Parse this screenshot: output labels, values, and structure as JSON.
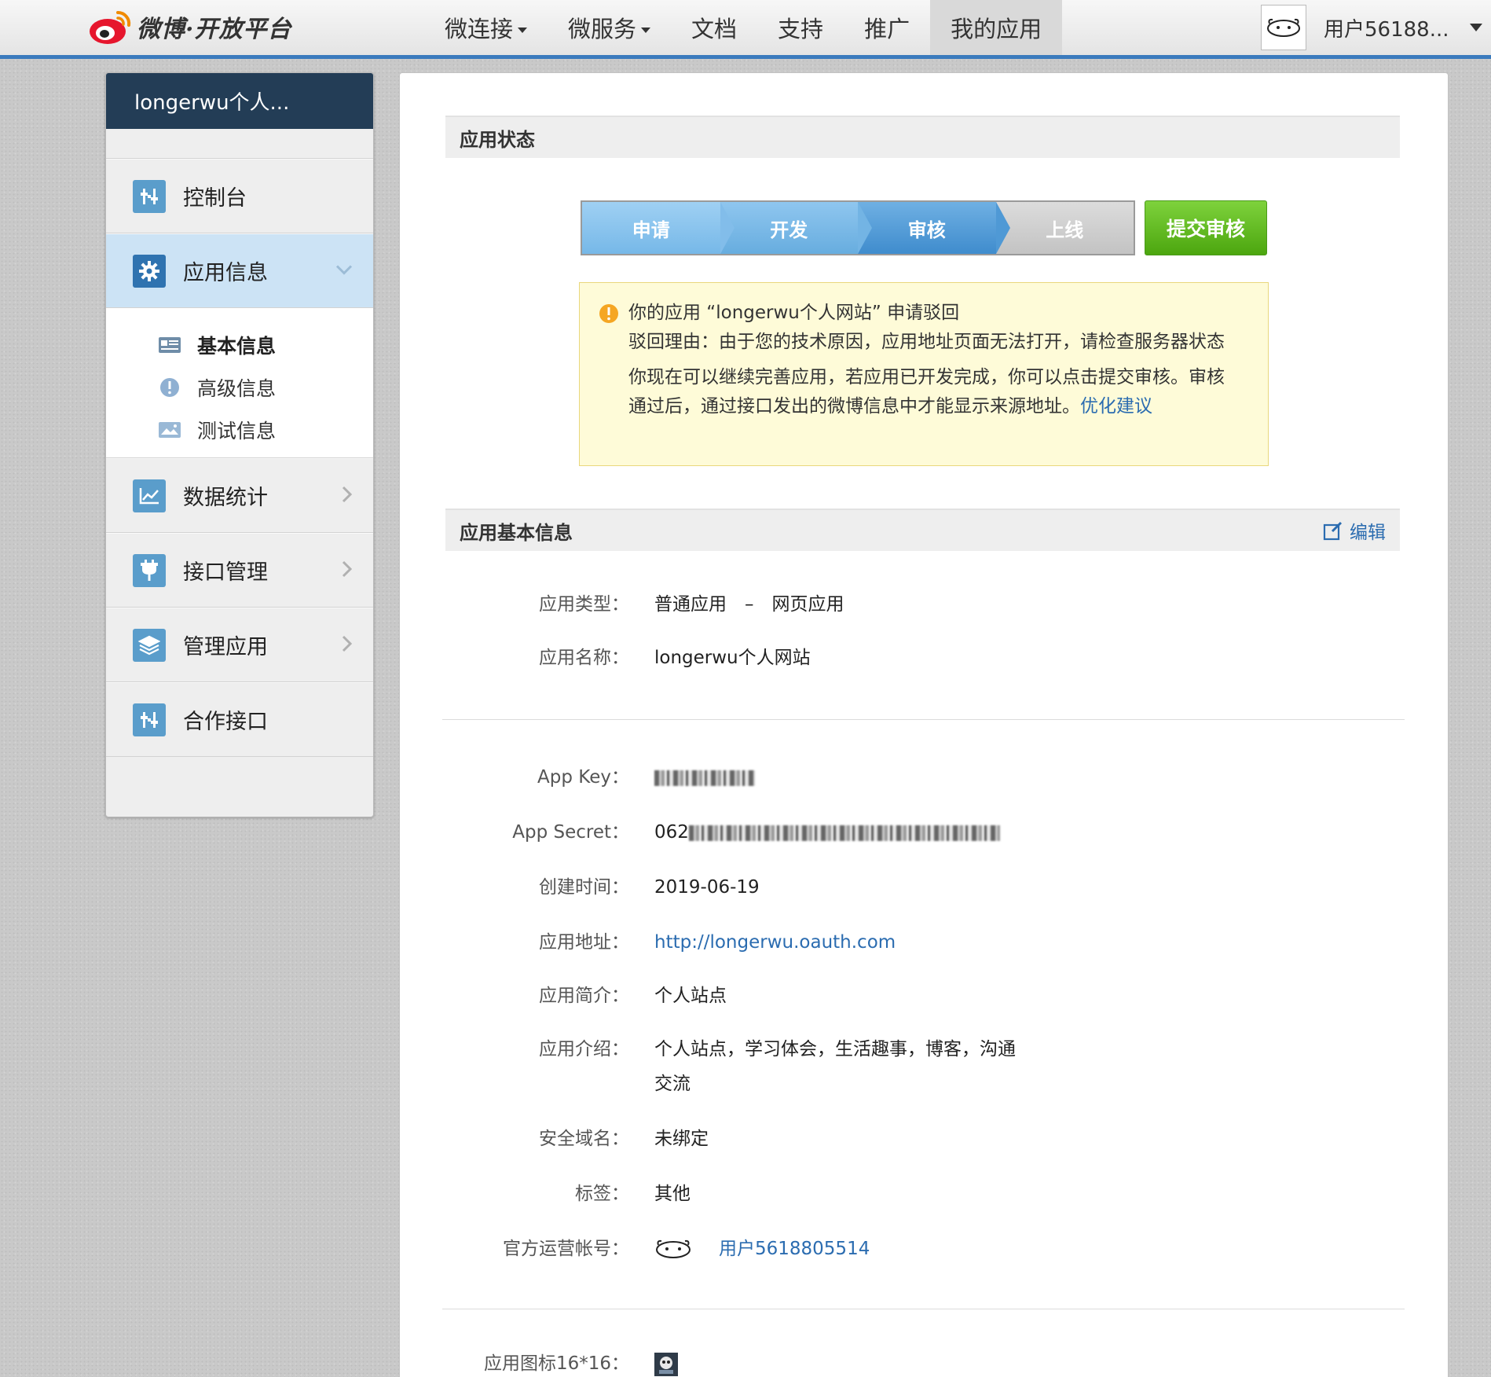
{
  "header": {
    "logo_text": "微博·开放平台",
    "nav": [
      {
        "label": "微连接",
        "dropdown": true
      },
      {
        "label": "微服务",
        "dropdown": true
      },
      {
        "label": "文档",
        "dropdown": false
      },
      {
        "label": "支持",
        "dropdown": false
      },
      {
        "label": "推广",
        "dropdown": false
      },
      {
        "label": "我的应用",
        "dropdown": false,
        "active": true
      }
    ],
    "user_name": "用户56188..."
  },
  "sidebar": {
    "app_title": "longerwu个人...",
    "items": [
      {
        "label": "控制台",
        "icon": "sliders-icon"
      },
      {
        "label": "应用信息",
        "icon": "gear-icon",
        "active": true
      },
      {
        "label": "数据统计",
        "icon": "line-chart-icon"
      },
      {
        "label": "接口管理",
        "icon": "plug-icon"
      },
      {
        "label": "管理应用",
        "icon": "layers-icon"
      },
      {
        "label": "合作接口",
        "icon": "sliders-icon"
      }
    ],
    "sub_items": [
      {
        "label": "基本信息",
        "icon": "id-card-icon",
        "selected": true
      },
      {
        "label": "高级信息",
        "icon": "info-circle-icon"
      },
      {
        "label": "测试信息",
        "icon": "image-icon"
      }
    ]
  },
  "status_section": {
    "title": "应用状态",
    "steps": [
      "申请",
      "开发",
      "审核",
      "上线"
    ],
    "current_step": 3,
    "submit_label": "提交审核",
    "notice": {
      "title": "你的应用 “longerwu个人网站” 申请驳回",
      "reason": "驳回理由：由于您的技术原因，应用地址页面无法打开，请检查服务器状态",
      "body": "你现在可以继续完善应用，若应用已开发完成，你可以点击提交审核。审核通过后，通过接口发出的微博信息中才能显示来源地址。",
      "link_label": "优化建议"
    }
  },
  "basic_section": {
    "title": "应用基本信息",
    "edit_label": "编辑",
    "fields": {
      "type_label": "应用类型：",
      "type_value": "普通应用　–　网页应用",
      "name_label": "应用名称：",
      "name_value": "longerwu个人网站",
      "app_key_label": "App Key：",
      "app_secret_label": "App Secret：",
      "app_secret_prefix": "062",
      "created_label": "创建时间：",
      "created_value": "2019-06-19",
      "url_label": "应用地址：",
      "url_value": "http://longerwu.oauth.com",
      "summary_label": "应用简介：",
      "summary_value": "个人站点",
      "intro_label": "应用介绍：",
      "intro_value": "个人站点，学习体会，生活趣事，博客，沟通交流",
      "domain_label": "安全域名：",
      "domain_value": "未绑定",
      "tags_label": "标签：",
      "tags_value": "其他",
      "official_label": "官方运营帐号：",
      "official_value": "用户5618805514",
      "icon16_label": "应用图标16*16："
    }
  },
  "colors": {
    "header_border": "#3b7bbd",
    "sidebar_head": "#233d56",
    "sidebar_active": "#cce3f5",
    "submit_green": "#5bb51b",
    "notice_bg": "#fefbd8",
    "link": "#2b6cb0"
  }
}
